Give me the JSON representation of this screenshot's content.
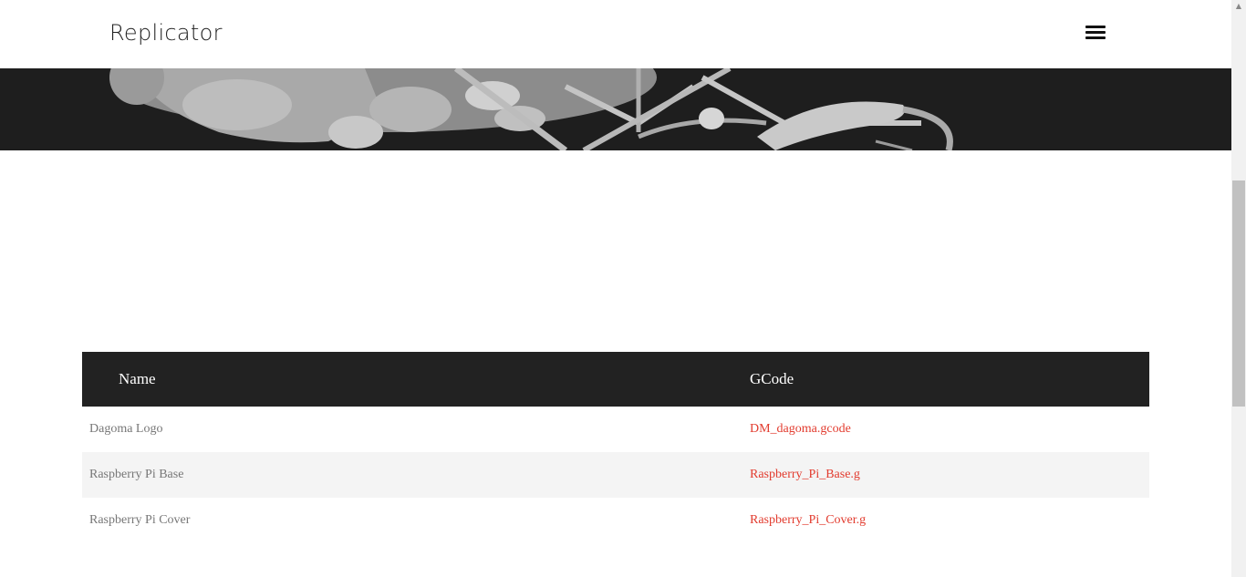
{
  "navbar": {
    "brand": "Replicator"
  },
  "table": {
    "headers": {
      "name": "Name",
      "gcode": "GCode"
    },
    "rows": [
      {
        "name": "Dagoma Logo",
        "gcode": "DM_dagoma.gcode"
      },
      {
        "name": "Raspberry Pi Base",
        "gcode": "Raspberry_Pi_Base.g"
      },
      {
        "name": "Raspberry Pi Cover",
        "gcode": "Raspberry_Pi_Cover.g"
      }
    ]
  },
  "colors": {
    "header_bg": "#222222",
    "link": "#e23b2e",
    "row_alt": "#f4f4f4"
  },
  "icons": {
    "menu": "hamburger-icon"
  }
}
